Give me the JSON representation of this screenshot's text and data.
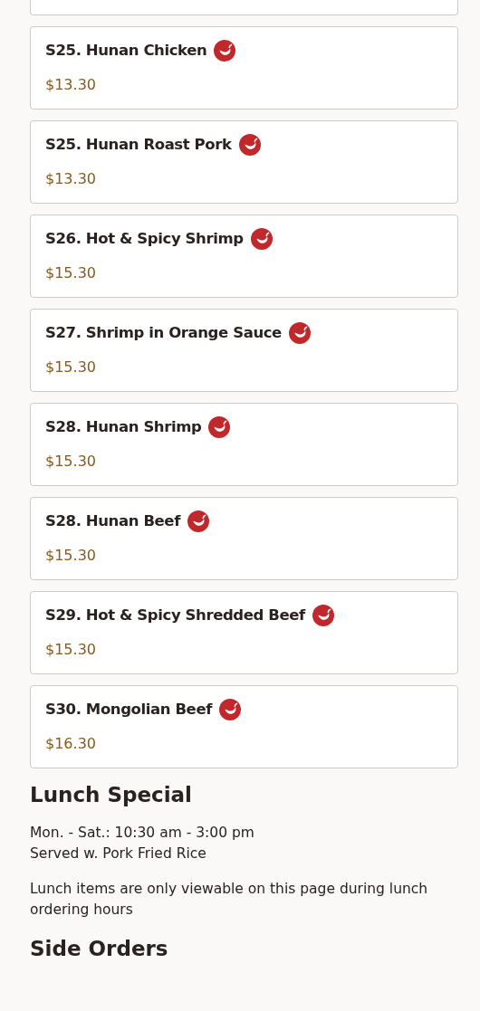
{
  "items": [
    {
      "name": "S25. Hunan Chicken",
      "spicy": true,
      "price": "$13.30"
    },
    {
      "name": "S25. Hunan Roast Pork",
      "spicy": true,
      "price": "$13.30"
    },
    {
      "name": "S26. Hot & Spicy Shrimp",
      "spicy": true,
      "price": "$15.30"
    },
    {
      "name": "S27. Shrimp in Orange Sauce",
      "spicy": true,
      "price": "$15.30"
    },
    {
      "name": "S28. Hunan Shrimp",
      "spicy": true,
      "price": "$15.30"
    },
    {
      "name": "S28. Hunan Beef",
      "spicy": true,
      "price": "$15.30"
    },
    {
      "name": "S29. Hot & Spicy Shredded Beef",
      "spicy": true,
      "price": "$15.30"
    },
    {
      "name": "S30. Mongolian Beef",
      "spicy": true,
      "price": "$16.30"
    }
  ],
  "sections": [
    {
      "title": "Lunch Special",
      "lines": [
        "Mon. - Sat.: 10:30 am - 3:00 pm",
        "Served w. Pork Fried Rice"
      ],
      "note": "Lunch items are only viewable on this page during lunch ordering hours"
    },
    {
      "title": "Side Orders"
    }
  ]
}
